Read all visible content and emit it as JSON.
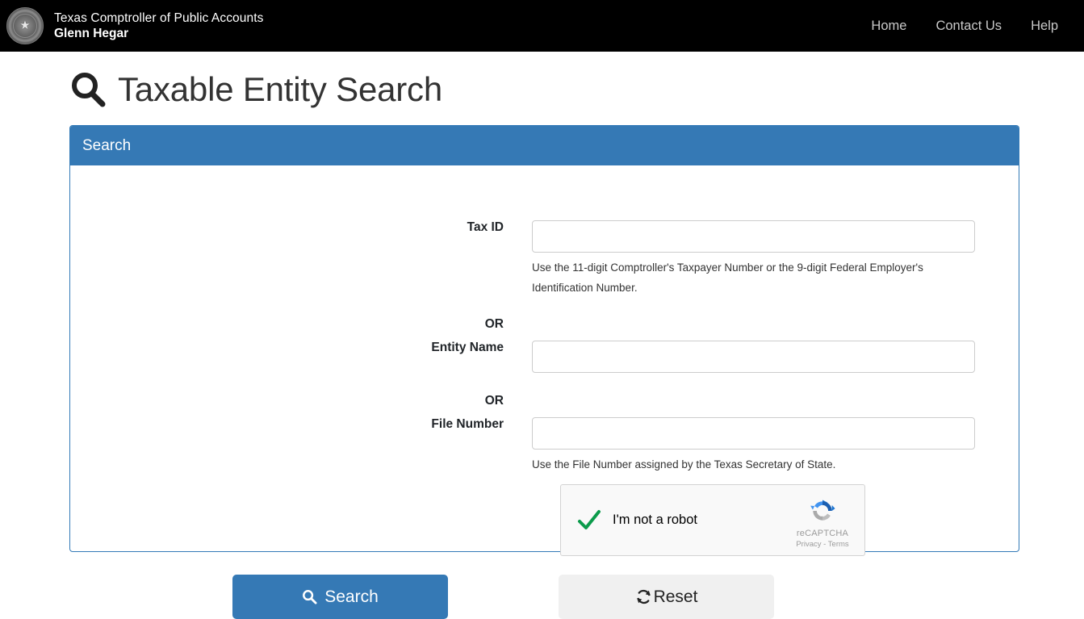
{
  "header": {
    "agency_name": "Texas Comptroller of Public Accounts",
    "official_name": "Glenn Hegar",
    "seal_icon": "texas-state-seal-icon",
    "nav": [
      {
        "label": "Home"
      },
      {
        "label": "Contact Us"
      },
      {
        "label": "Help"
      }
    ]
  },
  "page": {
    "title": "Taxable Entity Search",
    "title_icon": "search-icon"
  },
  "panel": {
    "heading": "Search",
    "accent_color": "#3579b5",
    "border_color": "#337ab7"
  },
  "form": {
    "tax_id": {
      "label": "Tax ID",
      "value": "",
      "placeholder": "",
      "help": "Use the 11-digit Comptroller's Taxpayer Number or the 9-digit Federal Employer's Identification Number."
    },
    "or_1": "OR",
    "entity_name": {
      "label": "Entity Name",
      "value": "",
      "placeholder": ""
    },
    "or_2": "OR",
    "file_number": {
      "label": "File Number",
      "value": "",
      "placeholder": "",
      "help": "Use the File Number assigned by the Texas Secretary of State."
    }
  },
  "recaptcha": {
    "label": "I'm not a robot",
    "checked": true,
    "check_icon": "green-checkmark-icon",
    "logo_icon": "recaptcha-logo-icon",
    "brand": "reCAPTCHA",
    "privacy": "Privacy",
    "separator": "-",
    "terms": "Terms",
    "check_color": "#0b9b4b"
  },
  "actions": {
    "search": {
      "label": "Search",
      "icon": "search-icon"
    },
    "reset": {
      "label": "Reset",
      "icon": "refresh-icon"
    }
  }
}
